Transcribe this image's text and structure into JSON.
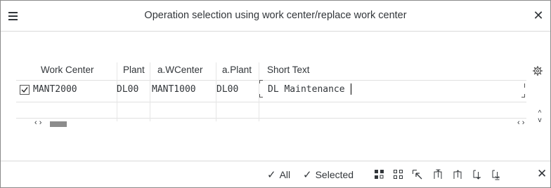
{
  "dialog": {
    "title": "Operation selection using work center/replace work center",
    "close_symbol": "✕",
    "menu_icon": "hamburger-menu-icon"
  },
  "table": {
    "columns": [
      "Work Center",
      "Plant",
      "a.WCenter",
      "a.Plant",
      "Short Text"
    ],
    "rows": [
      {
        "selected": true,
        "work_center": "MANT2000",
        "plant": "DL00",
        "a_wcenter": "MANT1000",
        "a_plant": "DL00",
        "short_text": "DL Maintenance"
      }
    ],
    "hscroll_left": "‹ ›",
    "hscroll_right": "‹ ›",
    "vscroll_up": "^",
    "vscroll_down": "v",
    "settings_icon": "settings-gear-icon"
  },
  "footer": {
    "all_label": "All",
    "selected_label": "Selected",
    "check_symbol": "✓",
    "close_symbol": "✕",
    "icons": [
      "select-block-icon",
      "deselect-all-icon",
      "choose-icon",
      "first-page-icon",
      "previous-page-icon",
      "next-page-icon",
      "last-page-icon",
      "cancel-icon"
    ]
  }
}
